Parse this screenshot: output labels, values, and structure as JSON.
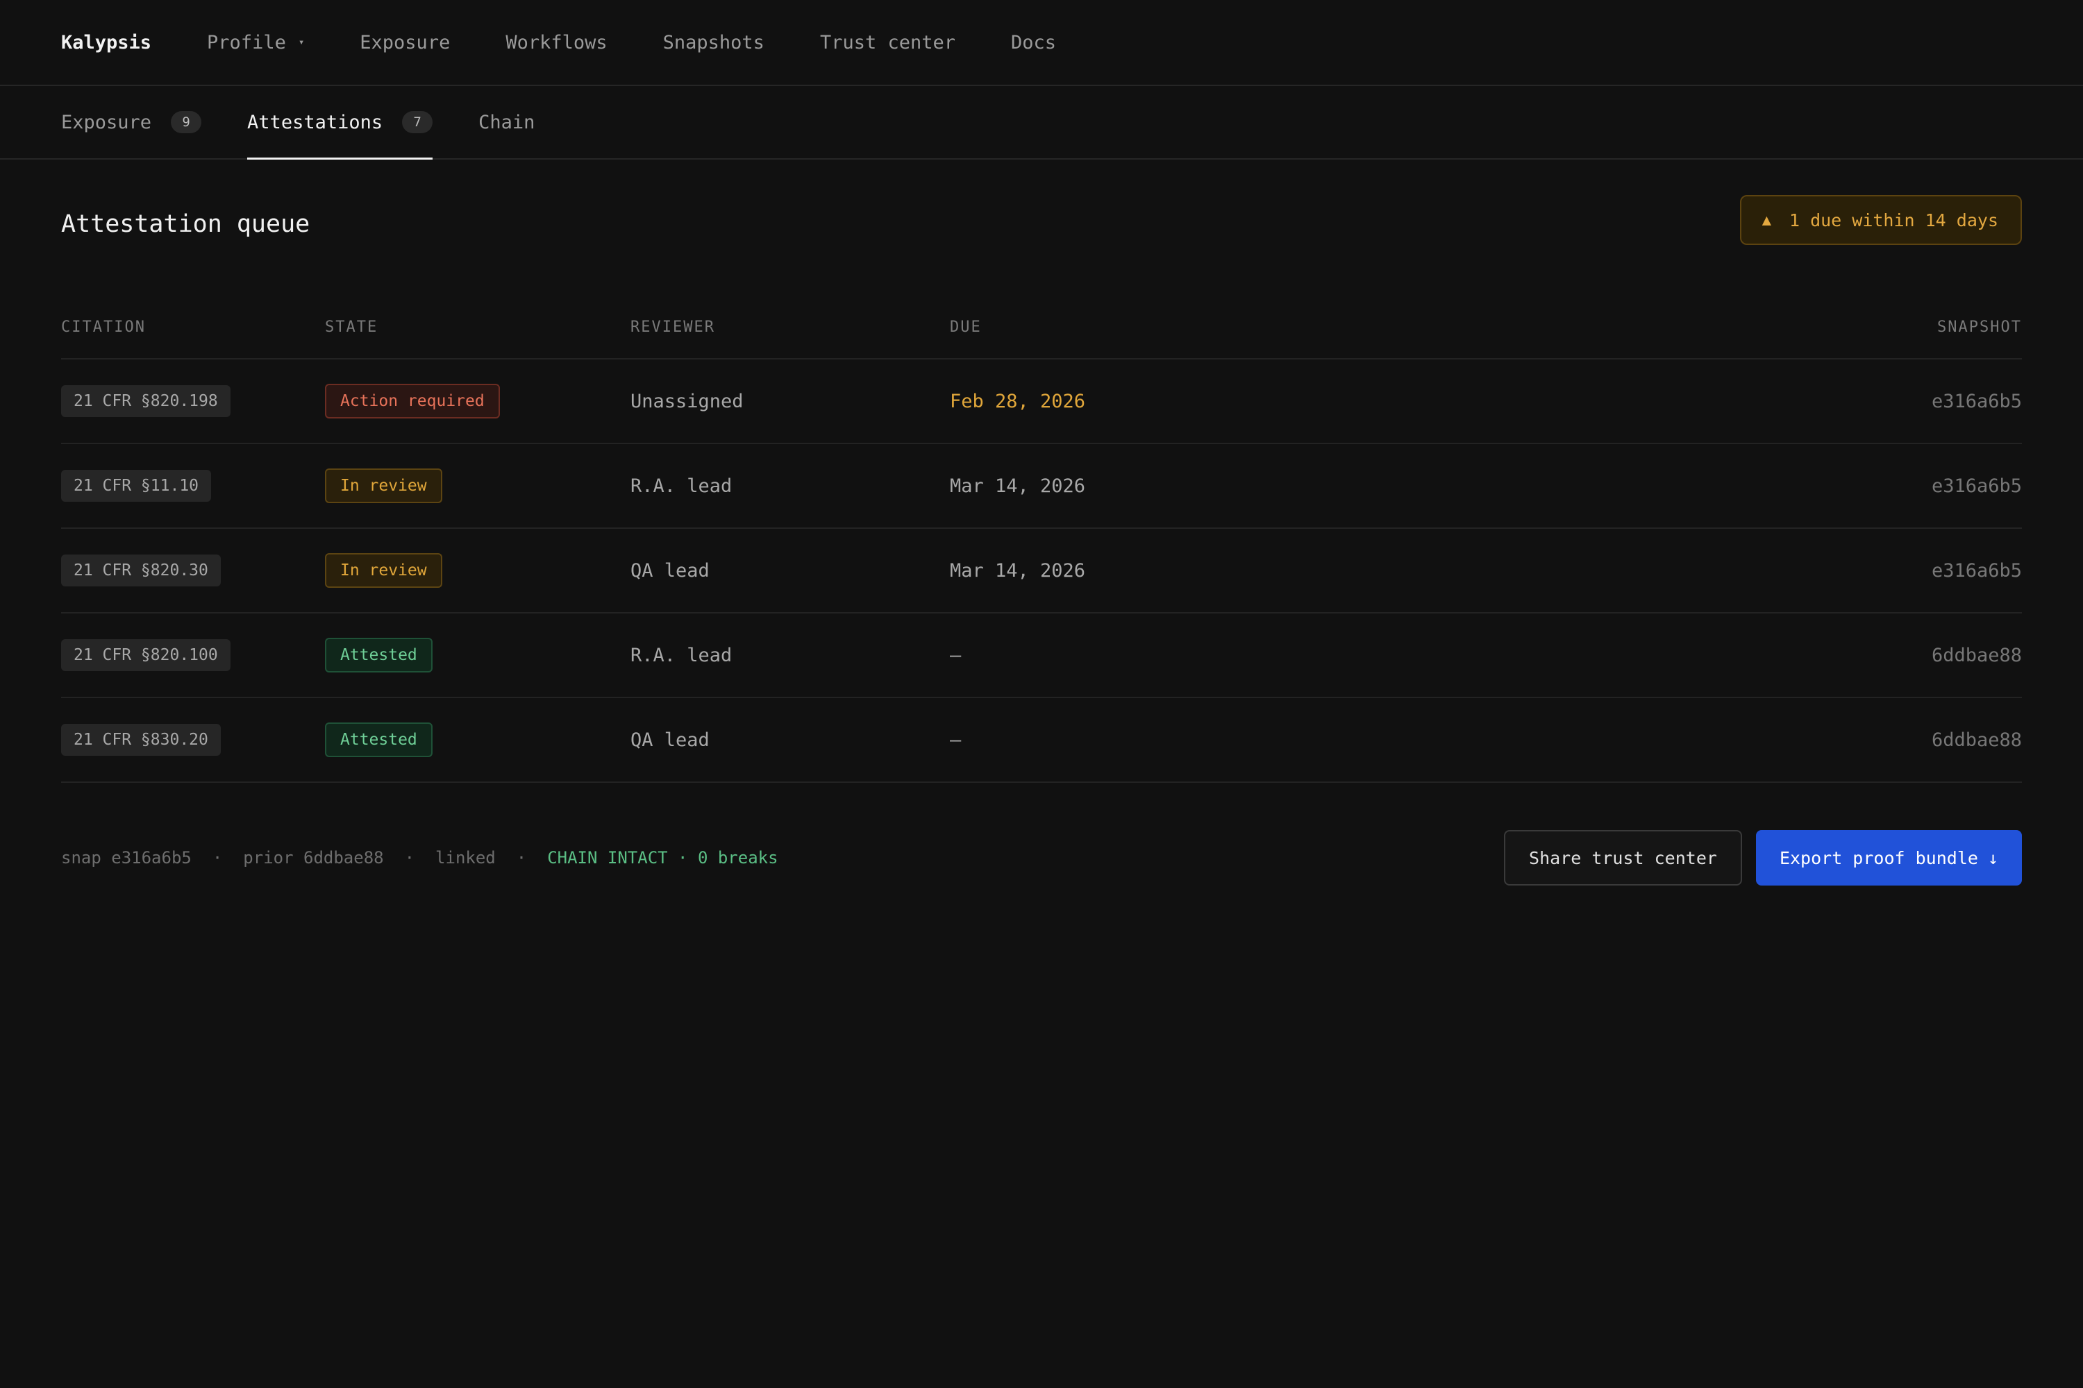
{
  "app": {
    "brand": "Kalypsis"
  },
  "nav": {
    "items": [
      {
        "label": "Profile",
        "dropdown": true
      },
      {
        "label": "Exposure"
      },
      {
        "label": "Workflows"
      },
      {
        "label": "Snapshots"
      },
      {
        "label": "Trust center"
      },
      {
        "label": "Docs"
      }
    ],
    "caret_glyph": "▾"
  },
  "tabs": [
    {
      "label": "Exposure",
      "count": "9",
      "active": false
    },
    {
      "label": "Attestations",
      "count": "7",
      "active": true
    },
    {
      "label": "Chain",
      "count": null,
      "active": false
    }
  ],
  "queue": {
    "title": "Attestation queue",
    "warning": {
      "icon": "warning-icon",
      "glyph": "▲",
      "text": "1 due within 14 days"
    },
    "columns": {
      "citation": "CITATION",
      "state": "STATE",
      "reviewer": "REVIEWER",
      "due": "DUE",
      "snapshot": "SNAPSHOT"
    },
    "rows": [
      {
        "citation": "21 CFR §820.198",
        "state": "Action required",
        "state_kind": "action",
        "reviewer": "Unassigned",
        "due": "Feb 28, 2026",
        "due_warn": true,
        "snapshot": "e316a6b5"
      },
      {
        "citation": "21 CFR §11.10",
        "state": "In review",
        "state_kind": "review",
        "reviewer": "R.A. lead",
        "due": "Mar 14, 2026",
        "due_warn": false,
        "snapshot": "e316a6b5"
      },
      {
        "citation": "21 CFR §820.30",
        "state": "In review",
        "state_kind": "review",
        "reviewer": "QA lead",
        "due": "Mar 14, 2026",
        "due_warn": false,
        "snapshot": "e316a6b5"
      },
      {
        "citation": "21 CFR §820.100",
        "state": "Attested",
        "state_kind": "attested",
        "reviewer": "R.A. lead",
        "due": "—",
        "due_warn": false,
        "snapshot": "6ddbae88"
      },
      {
        "citation": "21 CFR §830.20",
        "state": "Attested",
        "state_kind": "attested",
        "reviewer": "QA lead",
        "due": "—",
        "due_warn": false,
        "snapshot": "6ddbae88"
      }
    ]
  },
  "footer": {
    "snap": "snap e316a6b5",
    "prior": "prior 6ddbae88",
    "linked": "linked",
    "separator": "·",
    "chain_status": "CHAIN INTACT · 0 breaks",
    "share_label": "Share trust center",
    "export_label": "Export proof bundle",
    "export_icon": "download-arrow-icon",
    "export_glyph": "↓"
  },
  "colors": {
    "background": "#111111",
    "accent": "#2152d9",
    "warning": "#e0a63a",
    "danger": "#e8735a",
    "success": "#6fcf97"
  }
}
